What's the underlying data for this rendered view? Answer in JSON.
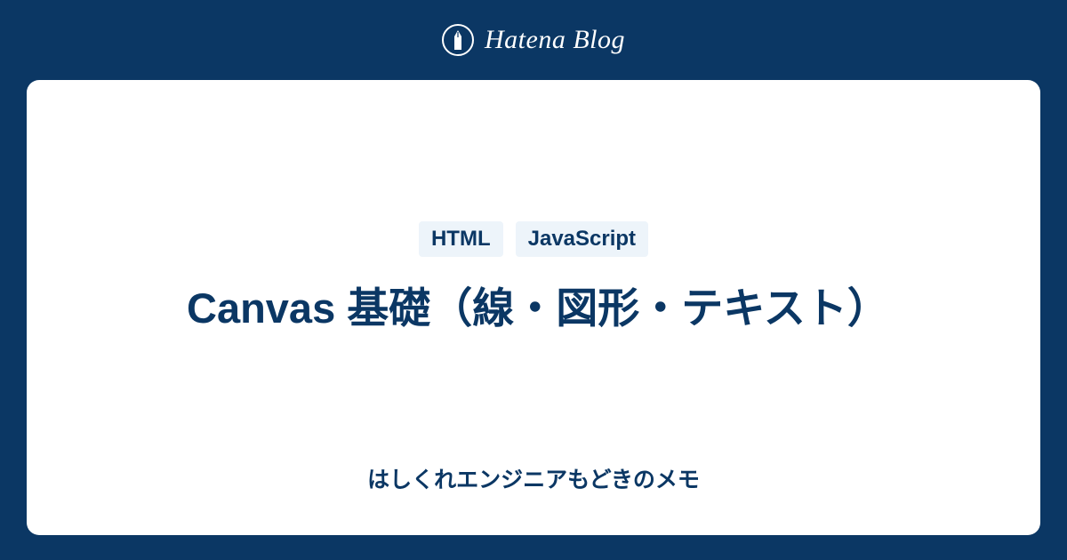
{
  "header": {
    "brand": "Hatena Blog"
  },
  "card": {
    "tags": [
      "HTML",
      "JavaScript"
    ],
    "title": "Canvas 基礎（線・図形・テキスト）",
    "subtitle": "はしくれエンジニアもどきのメモ"
  },
  "colors": {
    "background": "#0b3764",
    "card_bg": "#ffffff",
    "tag_bg": "#edf4fa",
    "text_primary": "#0b3764"
  }
}
